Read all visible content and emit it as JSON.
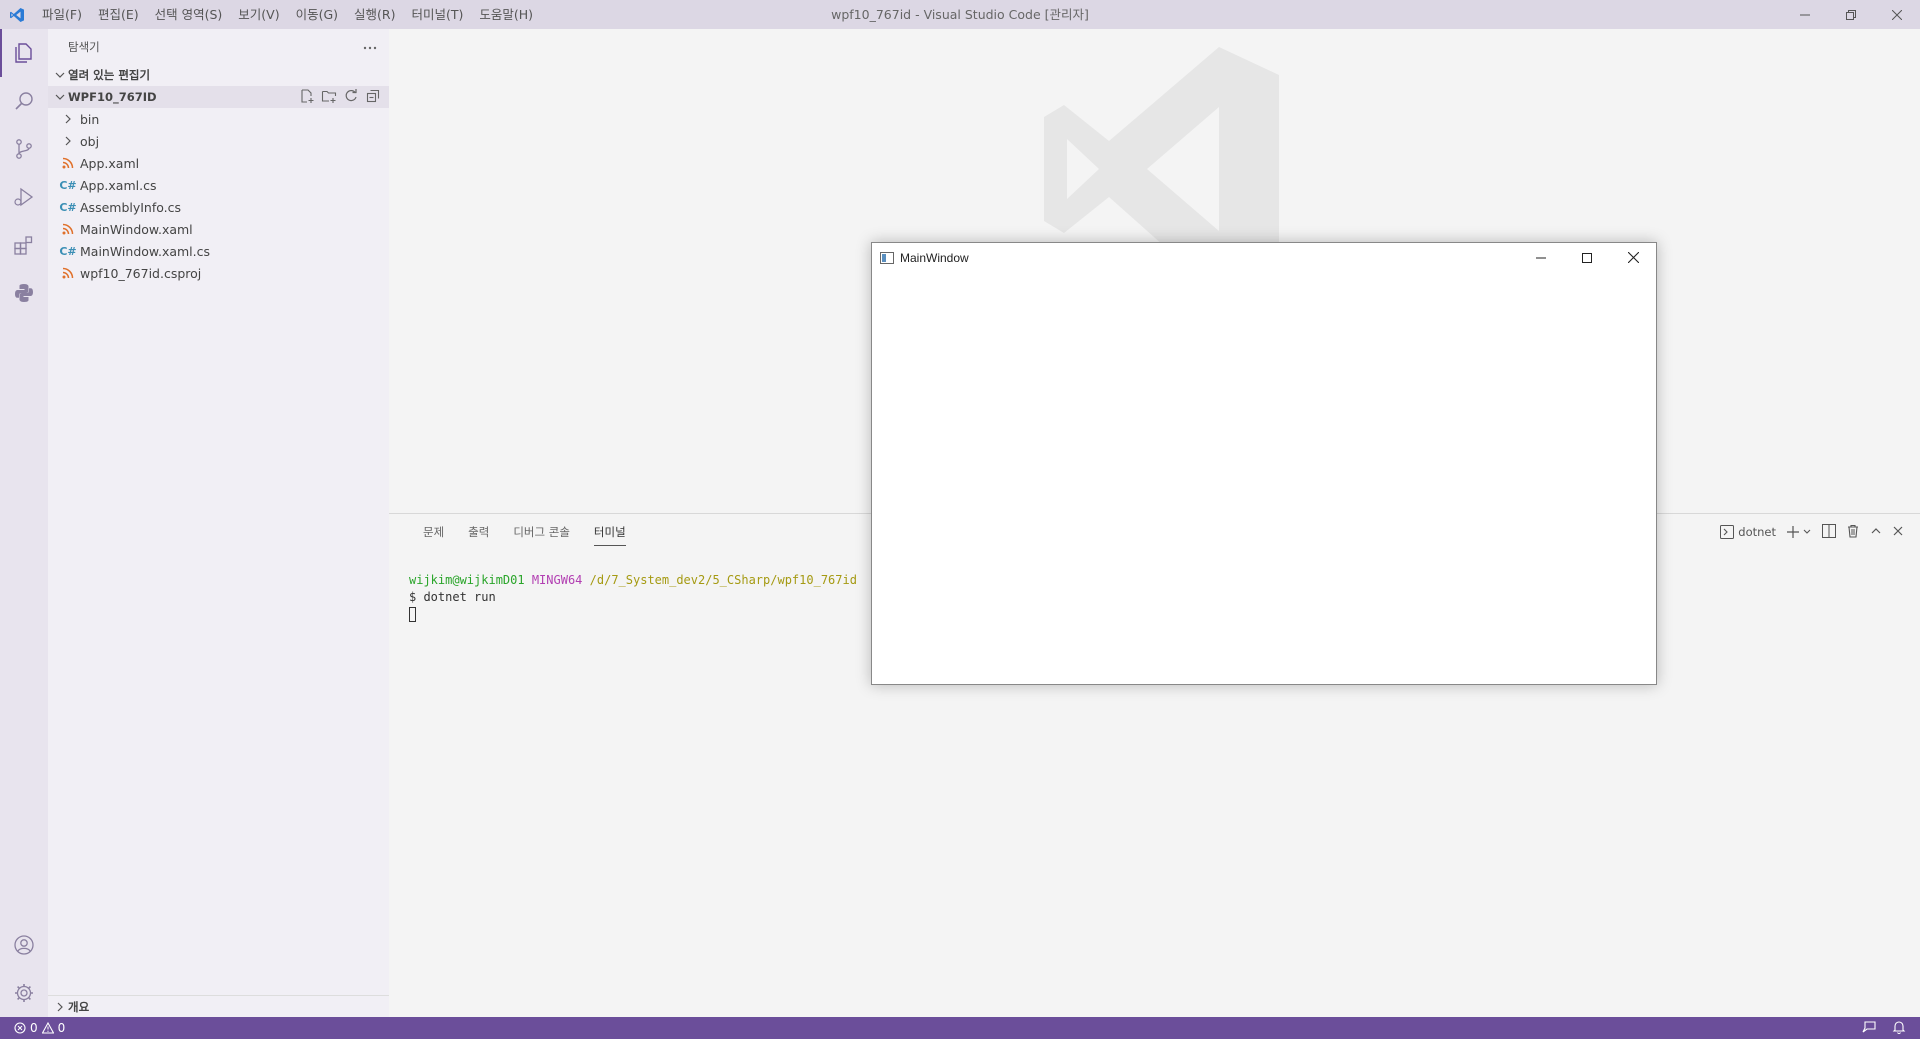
{
  "app": {
    "window_title": "wpf10_767id - Visual Studio Code [관리자]",
    "accent_color": "#6b4e9a"
  },
  "menu": [
    {
      "label": "파일(F)"
    },
    {
      "label": "편집(E)"
    },
    {
      "label": "선택 영역(S)"
    },
    {
      "label": "보기(V)"
    },
    {
      "label": "이동(G)"
    },
    {
      "label": "실행(R)"
    },
    {
      "label": "터미널(T)"
    },
    {
      "label": "도움말(H)"
    }
  ],
  "activity_bar": {
    "items": [
      "files-icon",
      "search-icon",
      "source-control-icon",
      "run-debug-icon",
      "extensions-icon",
      "python-icon"
    ],
    "bottom": [
      "account-icon",
      "gear-icon"
    ]
  },
  "sidebar": {
    "title": "탐색기",
    "open_editors": "열려 있는 편집기",
    "folder": "WPF10_767ID",
    "items": [
      {
        "label": "bin",
        "type": "folder"
      },
      {
        "label": "obj",
        "type": "folder"
      },
      {
        "label": "App.xaml",
        "type": "xaml"
      },
      {
        "label": "App.xaml.cs",
        "type": "cs"
      },
      {
        "label": "AssemblyInfo.cs",
        "type": "cs"
      },
      {
        "label": "MainWindow.xaml",
        "type": "xaml"
      },
      {
        "label": "MainWindow.xaml.cs",
        "type": "cs"
      },
      {
        "label": "wpf10_767id.csproj",
        "type": "xaml"
      }
    ],
    "outline": "개요"
  },
  "panel": {
    "tabs": [
      {
        "label": "문제"
      },
      {
        "label": "출력"
      },
      {
        "label": "디버그 콘솔"
      },
      {
        "label": "터미널"
      }
    ],
    "terminal_name": "dotnet",
    "terminal": {
      "user": "wijkim@wijkimD01",
      "host": "MINGW64",
      "path": "/d/7_System_dev2/5_CSharp/wpf10_767id",
      "command": "$ dotnet run"
    }
  },
  "main_window": {
    "title": "MainWindow"
  },
  "statusbar": {
    "errors": "0",
    "warnings": "0"
  }
}
